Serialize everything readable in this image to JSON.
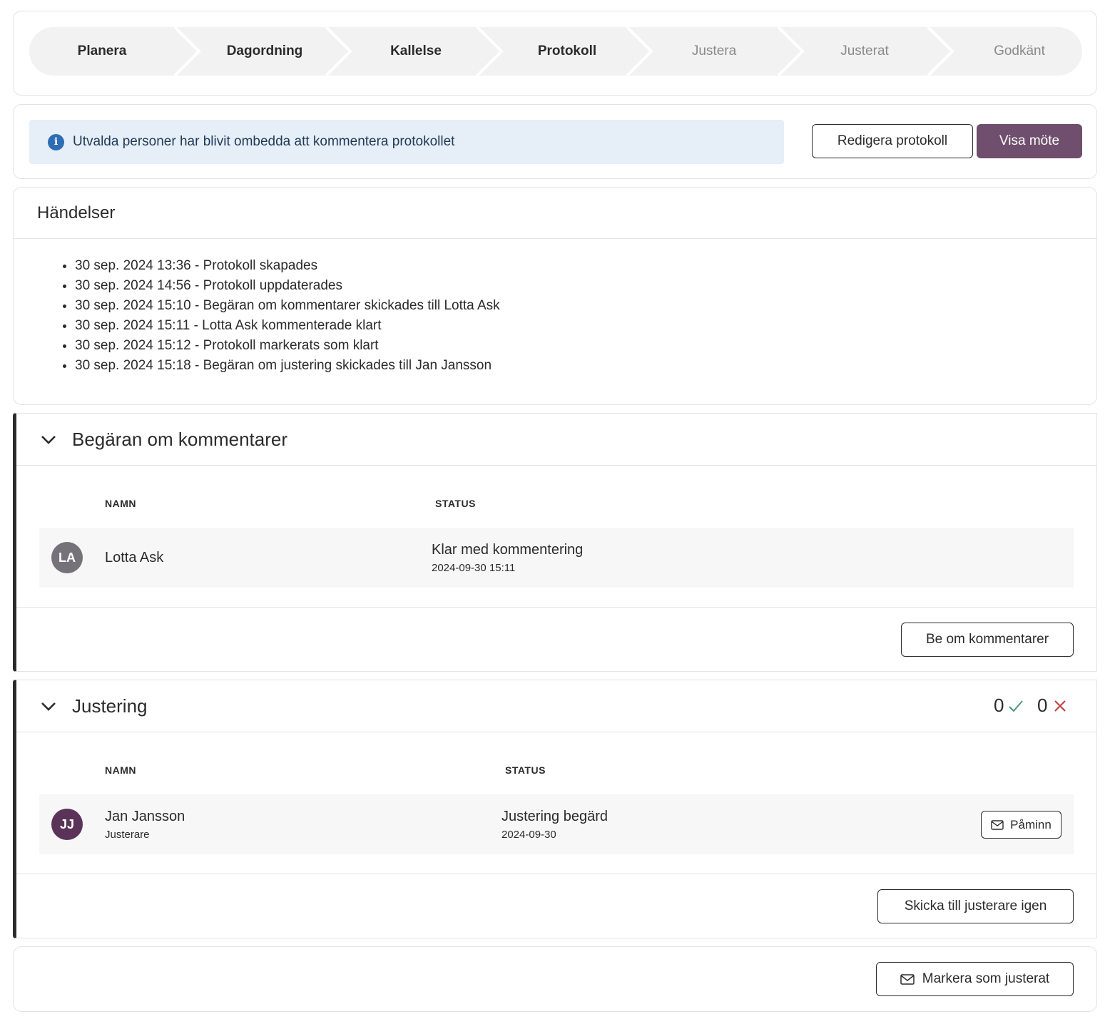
{
  "stepper": {
    "steps": [
      {
        "label": "Planera",
        "state": "done"
      },
      {
        "label": "Dagordning",
        "state": "done"
      },
      {
        "label": "Kallelse",
        "state": "done"
      },
      {
        "label": "Protokoll",
        "state": "current"
      },
      {
        "label": "Justera",
        "state": "upcoming"
      },
      {
        "label": "Justerat",
        "state": "upcoming"
      },
      {
        "label": "Godkänt",
        "state": "upcoming"
      }
    ]
  },
  "info": {
    "icon": "info-icon",
    "message": "Utvalda personer har blivit ombedda att kommentera protokollet",
    "edit_button": "Redigera protokoll",
    "view_button": "Visa möte"
  },
  "events": {
    "title": "Händelser",
    "items": [
      "30 sep. 2024 13:36 - Protokoll skapades",
      "30 sep. 2024 14:56 - Protokoll uppdaterades",
      "30 sep. 2024 15:10 - Begäran om kommentarer skickades till Lotta Ask",
      "30 sep. 2024 15:11 - Lotta Ask kommenterade klart",
      "30 sep. 2024 15:12 - Protokoll markerats som klart",
      "30 sep. 2024 15:18 - Begäran om justering skickades till Jan Jansson"
    ]
  },
  "comments": {
    "title": "Begäran om kommentarer",
    "col_name": "NAMN",
    "col_status": "STATUS",
    "rows": [
      {
        "initials": "LA",
        "name": "Lotta Ask",
        "status": "Klar med kommentering",
        "status_time": "2024-09-30 15:11",
        "avatar_color": "#75727a"
      }
    ],
    "button": "Be om kommentarer"
  },
  "justering": {
    "title": "Justering",
    "approved_count": "0",
    "rejected_count": "0",
    "approved_color": "#4a9a7a",
    "rejected_color": "#c43a3a",
    "col_name": "NAMN",
    "col_status": "STATUS",
    "rows": [
      {
        "initials": "JJ",
        "name": "Jan Jansson",
        "role": "Justerare",
        "status": "Justering begärd",
        "status_time": "2024-09-30",
        "remind_button": "Påminn",
        "avatar_color": "#5b3359"
      }
    ],
    "button": "Skicka till justerare igen"
  },
  "footer": {
    "button": "Markera som justerat"
  },
  "colors": {
    "primary": "#6f4f6d",
    "info_bg": "#e6eef7",
    "info_icon": "#2f6db3"
  }
}
